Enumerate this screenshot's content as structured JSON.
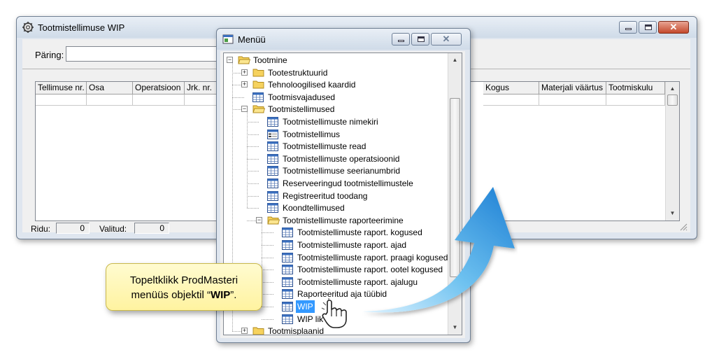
{
  "wip_window": {
    "title": "Tootmistellimuse WIP",
    "query_label": "Päring:",
    "query_value": "",
    "columns": [
      "Tellimuse nr.",
      "Osa",
      "Operatsioon",
      "Jrk. nr.",
      "Kogus",
      "Materjali väärtus",
      "Tootmiskulu"
    ],
    "status": {
      "rows_label": "Ridu:",
      "rows_value": "0",
      "selected_label": "Valitud:",
      "selected_value": "0"
    }
  },
  "menu_window": {
    "title": "Menüü",
    "tree": [
      {
        "label": "Tootmine",
        "icon": "folder-open-icon",
        "level": 0,
        "expander": "minus"
      },
      {
        "label": "Tootestruktuurid",
        "icon": "folder-icon",
        "level": 1,
        "expander": "plus"
      },
      {
        "label": "Tehnoloogilised kaardid",
        "icon": "folder-icon",
        "level": 1,
        "expander": "plus"
      },
      {
        "label": "Tootmisvajadused",
        "icon": "table-icon",
        "level": 1,
        "expander": ""
      },
      {
        "label": "Tootmistellimused",
        "icon": "folder-open-icon",
        "level": 1,
        "expander": "minus"
      },
      {
        "label": "Tootmistellimuste nimekiri",
        "icon": "table-icon",
        "level": 2,
        "expander": ""
      },
      {
        "label": "Tootmistellimus",
        "icon": "form-icon",
        "level": 2,
        "expander": ""
      },
      {
        "label": "Tootmistellimuste read",
        "icon": "table-icon",
        "level": 2,
        "expander": ""
      },
      {
        "label": "Tootmistellimuste operatsioonid",
        "icon": "table-icon",
        "level": 2,
        "expander": ""
      },
      {
        "label": "Tootmistellimuse seerianumbrid",
        "icon": "table-icon",
        "level": 2,
        "expander": ""
      },
      {
        "label": "Reserveeringud tootmistellimustele",
        "icon": "table-icon",
        "level": 2,
        "expander": ""
      },
      {
        "label": "Registreeritud toodang",
        "icon": "table-icon",
        "level": 2,
        "expander": ""
      },
      {
        "label": "Koondtellimused",
        "icon": "table-icon",
        "level": 2,
        "expander": ""
      },
      {
        "label": "Tootmistellimuste raporteerimine",
        "icon": "folder-open-icon",
        "level": 2,
        "expander": "minus"
      },
      {
        "label": "Tootmistellimuste raport. kogused",
        "icon": "table-icon",
        "level": 3,
        "expander": ""
      },
      {
        "label": "Tootmistellimuste raport. ajad",
        "icon": "table-icon",
        "level": 3,
        "expander": ""
      },
      {
        "label": "Tootmistellimuste raport. praagi kogused",
        "icon": "table-icon",
        "level": 3,
        "expander": ""
      },
      {
        "label": "Tootmistellimuste raport. ootel kogused",
        "icon": "table-icon",
        "level": 3,
        "expander": ""
      },
      {
        "label": "Tootmistellimuste raport. ajalugu",
        "icon": "table-icon",
        "level": 3,
        "expander": ""
      },
      {
        "label": "Raporteeritud aja tüübid",
        "icon": "table-icon",
        "level": 3,
        "expander": ""
      },
      {
        "label": "WIP",
        "icon": "table-icon",
        "level": 3,
        "expander": "",
        "selected": true
      },
      {
        "label": "WIP lik",
        "icon": "table-icon",
        "level": 3,
        "expander": ""
      },
      {
        "label": "Tootmisplaanid",
        "icon": "folder-icon",
        "level": 1,
        "expander": "plus"
      }
    ]
  },
  "callout": {
    "line1": "Topeltklikk ProdMasteri",
    "line2_prefix": "menüüs objektil “",
    "line2_bold": "WIP",
    "line2_suffix": "”."
  },
  "colors": {
    "selection": "#3399ff",
    "arrow_light": "#bfe6fb",
    "arrow_dark": "#1e86d6",
    "callout_fill": "#fff6b0",
    "close_button": "#c44a2d"
  }
}
